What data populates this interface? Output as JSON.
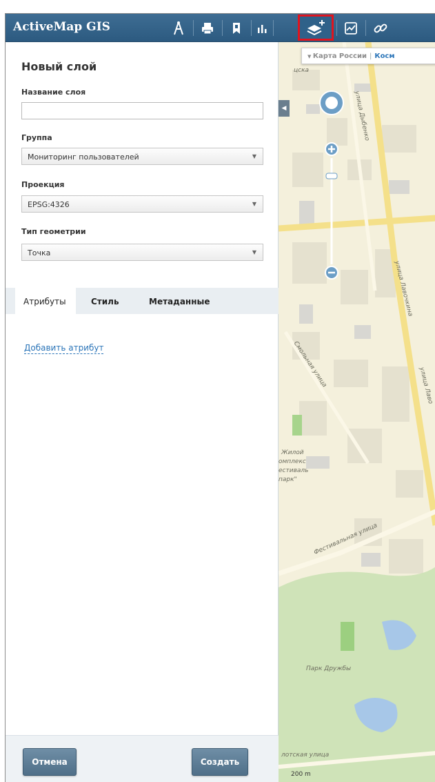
{
  "app": {
    "title": "ActiveMap GIS"
  },
  "toolbar": {
    "tools": [
      {
        "icon": "compass-icon"
      },
      {
        "icon": "print-icon"
      },
      {
        "icon": "bookmark-icon"
      },
      {
        "icon": "bar-chart-icon"
      },
      {
        "icon": "add-layer-icon"
      },
      {
        "icon": "line-chart-icon"
      },
      {
        "icon": "link-icon"
      }
    ],
    "active_tool": "add-layer-icon",
    "highlight_color": "#e0141e"
  },
  "panel": {
    "title": "Новый слой",
    "layer_name": {
      "label": "Название слоя",
      "value": ""
    },
    "group": {
      "label": "Группа",
      "value": "Мониторинг пользователей"
    },
    "projection": {
      "label": "Проекция",
      "value": "EPSG:4326"
    },
    "geometry": {
      "label": "Тип геометрии",
      "value": "Точка"
    },
    "tabs": [
      "Атрибуты",
      "Стиль",
      "Метаданные"
    ],
    "active_tab": "Атрибуты",
    "add_attribute_link": "Добавить атрибут",
    "cancel_label": "Отмена",
    "create_label": "Создать"
  },
  "map": {
    "basemap_russia": "Карта России",
    "basemap_sat": "Косм",
    "labels": {
      "top_cut": "цска",
      "dybenko": "улица Дыбенко",
      "lavochkina": "улица Лавочкина",
      "lavochkina2": "улица Лаво",
      "smolnaya": "Смольная улица",
      "complex1": "Жилой",
      "complex2": "омплекс",
      "complex3": "естиваль",
      "complex4": "парк\"",
      "festivalnaya": "Фестивальная улица",
      "park": "Парк Дружбы",
      "flotskaya": "лотская улица"
    },
    "scale": "200 m"
  }
}
